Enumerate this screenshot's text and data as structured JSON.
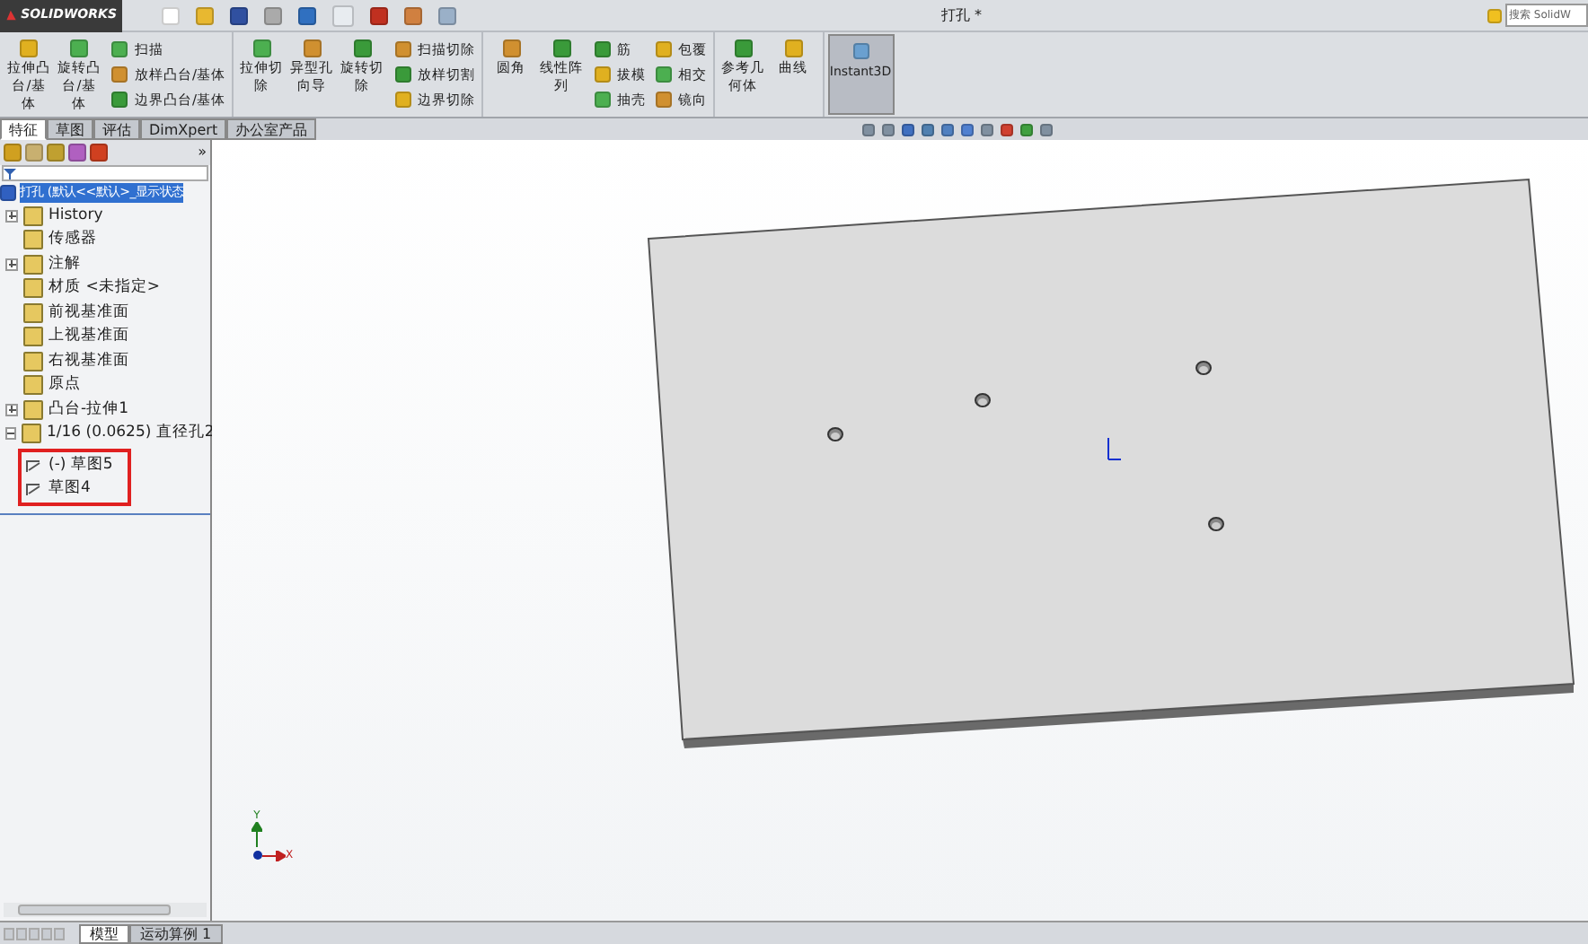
{
  "app": {
    "logo": "SOLIDWORKS",
    "document_title": "打孔 *",
    "search": {
      "placeholder": "搜索 SolidW"
    }
  },
  "ribbon": {
    "groups": [
      {
        "large": [
          {
            "label": "拉伸凸台/基体"
          },
          {
            "label": "旋转凸台/基体"
          }
        ],
        "small": [
          [
            {
              "label": "扫描"
            },
            {
              "label": "放样凸台/基体"
            },
            {
              "label": "边界凸台/基体"
            }
          ]
        ]
      },
      {
        "large": [
          {
            "label": "拉伸切除"
          },
          {
            "label": "异型孔向导"
          },
          {
            "label": "旋转切除"
          }
        ],
        "small": [
          [
            {
              "label": "扫描切除"
            },
            {
              "label": "放样切割"
            },
            {
              "label": "边界切除"
            }
          ]
        ]
      },
      {
        "large": [
          {
            "label": "圆角"
          },
          {
            "label": "线性阵列"
          }
        ],
        "small": [
          [
            {
              "label": "筋"
            },
            {
              "label": "拔模"
            },
            {
              "label": "抽壳"
            }
          ],
          [
            {
              "label": "包覆"
            },
            {
              "label": "相交"
            },
            {
              "label": "镜向"
            }
          ]
        ]
      },
      {
        "large": [
          {
            "label": "参考几何体"
          },
          {
            "label": "曲线"
          }
        ]
      }
    ],
    "instant3d": {
      "label": "Instant3D",
      "selected": true
    }
  },
  "tabs": [
    {
      "label": "特征",
      "selected": true
    },
    {
      "label": "草图",
      "selected": false
    },
    {
      "label": "评估",
      "selected": false
    },
    {
      "label": "DimXpert",
      "selected": false
    },
    {
      "label": "办公室产品",
      "selected": false
    }
  ],
  "panel": {
    "more": "»",
    "root": {
      "label": "打孔 (默认<<默认>_显示状态",
      "selected": true
    },
    "tree": [
      {
        "label": "History",
        "expanded": false
      },
      {
        "label": "传感器"
      },
      {
        "label": "注解",
        "expanded": false
      },
      {
        "label": "材质 <未指定>"
      },
      {
        "label": "前视基准面"
      },
      {
        "label": "上视基准面"
      },
      {
        "label": "右视基准面"
      },
      {
        "label": "原点"
      },
      {
        "label": "凸台-拉伸1",
        "expanded": false
      },
      {
        "label": "1/16 (0.0625) 直径孔2",
        "expanded": true,
        "children": [
          {
            "label": "(-) 草图5"
          },
          {
            "label": "草图4"
          }
        ]
      }
    ]
  },
  "triad": {
    "y": "Y",
    "x": "X"
  },
  "bottom_tabs": [
    {
      "label": "模型",
      "selected": true
    },
    {
      "label": "运动算例 1",
      "selected": false
    }
  ]
}
